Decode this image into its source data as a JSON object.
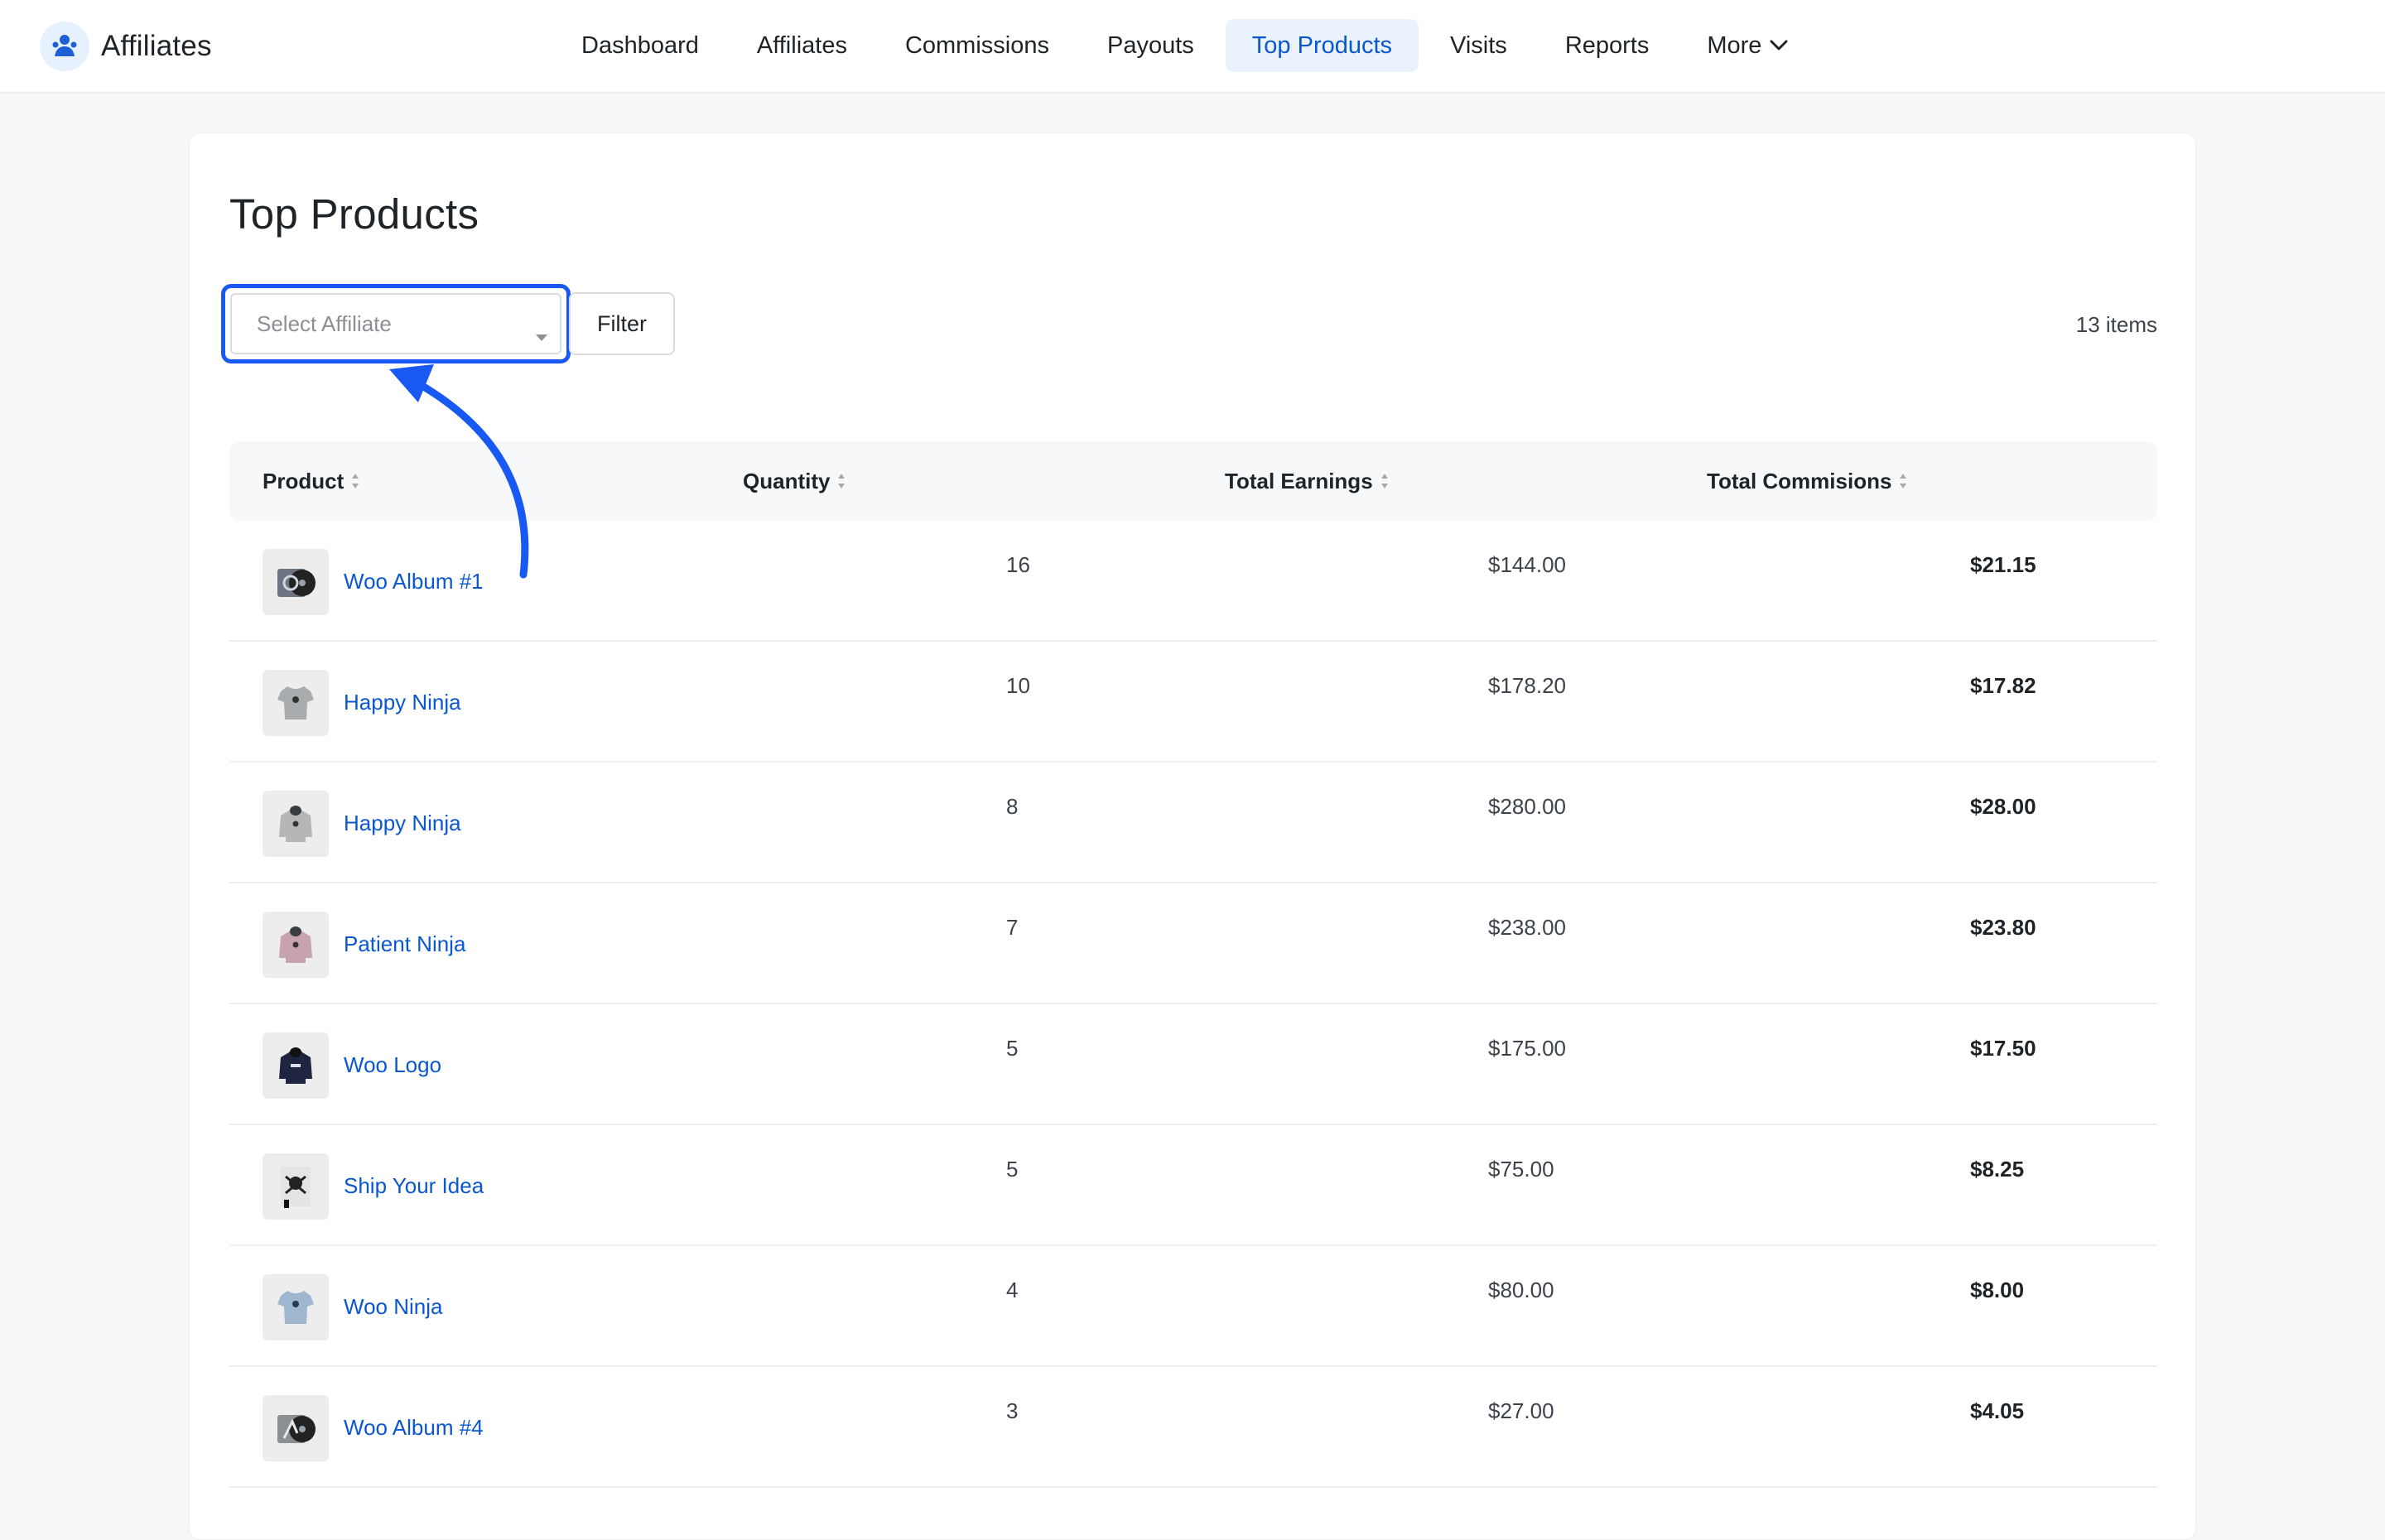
{
  "app": {
    "name": "Affiliates"
  },
  "nav": {
    "items": [
      {
        "label": "Dashboard"
      },
      {
        "label": "Affiliates"
      },
      {
        "label": "Commissions"
      },
      {
        "label": "Payouts"
      },
      {
        "label": "Top Products",
        "active": true
      },
      {
        "label": "Visits"
      },
      {
        "label": "Reports"
      },
      {
        "label": "More",
        "has_dropdown": true
      }
    ]
  },
  "page": {
    "title": "Top Products",
    "affiliate_select": {
      "placeholder": "Select Affiliate"
    },
    "filter_label": "Filter",
    "items_count": "13 items"
  },
  "table": {
    "columns": [
      "Product",
      "Quantity",
      "Total Earnings",
      "Total Commisions"
    ],
    "rows": [
      {
        "product": "Woo Album #1",
        "quantity": "16",
        "earnings": "$144.00",
        "commission": "$21.15",
        "thumb": "album-icon"
      },
      {
        "product": "Happy Ninja",
        "quantity": "10",
        "earnings": "$178.20",
        "commission": "$17.82",
        "thumb": "tshirt-icon"
      },
      {
        "product": "Happy Ninja",
        "quantity": "8",
        "earnings": "$280.00",
        "commission": "$28.00",
        "thumb": "hoodie-icon"
      },
      {
        "product": "Patient Ninja",
        "quantity": "7",
        "earnings": "$238.00",
        "commission": "$23.80",
        "thumb": "hoodie-icon"
      },
      {
        "product": "Woo Logo",
        "quantity": "5",
        "earnings": "$175.00",
        "commission": "$17.50",
        "thumb": "hoodie-icon"
      },
      {
        "product": "Ship Your Idea",
        "quantity": "5",
        "earnings": "$75.00",
        "commission": "$8.25",
        "thumb": "poster-icon"
      },
      {
        "product": "Woo Ninja",
        "quantity": "4",
        "earnings": "$80.00",
        "commission": "$8.00",
        "thumb": "tshirt-icon"
      },
      {
        "product": "Woo Album #4",
        "quantity": "3",
        "earnings": "$27.00",
        "commission": "$4.05",
        "thumb": "album-icon"
      }
    ]
  },
  "colors": {
    "accent": "#0a57d0",
    "highlight": "#1859f3",
    "active_nav_bg": "#eaf2fd"
  }
}
